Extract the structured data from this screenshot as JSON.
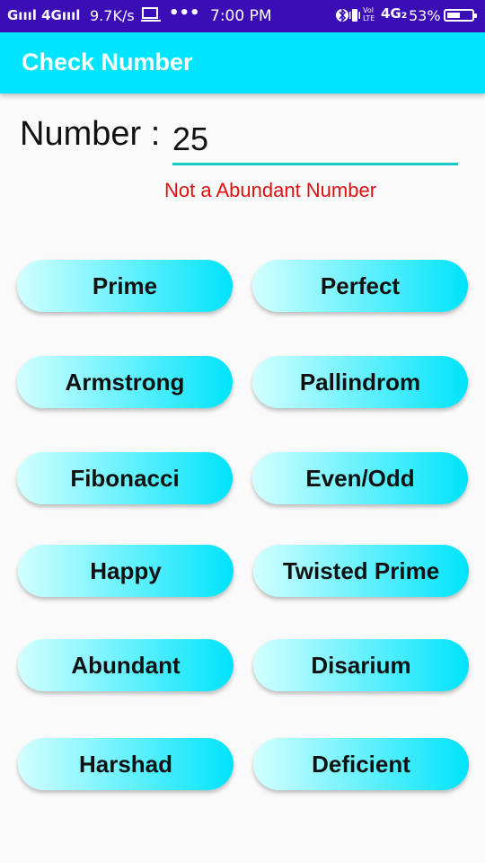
{
  "status_bar": {
    "signal": "Gıııl 4Gıııl",
    "speed": "9.7K/s",
    "time": "7:00 PM",
    "battery_percent": "53%",
    "battery_level": 0.53,
    "volte": "Vol LTE",
    "network": "4G₂"
  },
  "app_bar": {
    "title": "Check Number"
  },
  "form": {
    "label": "Number :",
    "value": "25",
    "result": "Not a Abundant Number"
  },
  "buttons": {
    "prime": "Prime",
    "perfect": "Perfect",
    "armstrong": "Armstrong",
    "pallindrom": "Pallindrom",
    "fibonacci": "Fibonacci",
    "even_odd": "Even/Odd",
    "happy": "Happy",
    "twisted_prime": "Twisted Prime",
    "abundant": "Abundant",
    "disarium": "Disarium",
    "harshad": "Harshad",
    "deficient": "Deficient"
  },
  "colors": {
    "status_bar": "#3a0db5",
    "app_bar": "#00e5ff",
    "error": "#e01010",
    "underline": "#16c9c6"
  }
}
